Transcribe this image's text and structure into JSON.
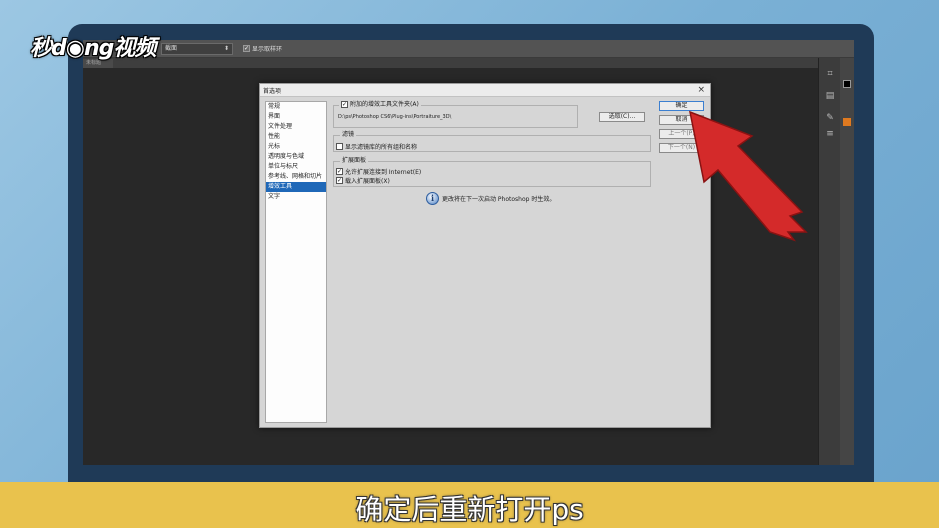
{
  "logo": {
    "text": "秒d◉ng视频"
  },
  "caption": "确定后重新打开ps",
  "optbar": {
    "select_value": "截面",
    "checkbox_label": "显示取样环"
  },
  "tab": {
    "label": "未标题"
  },
  "dialog": {
    "title": "首选项",
    "close": "×",
    "categories": [
      "常规",
      "界面",
      "文件处理",
      "性能",
      "光标",
      "透明度与色域",
      "单位与标尺",
      "参考线、网格和切片",
      "增效工具",
      "文字"
    ],
    "selected_category": "增效工具",
    "plugins_group": {
      "checkbox_label": "附加的增效工具文件夹(A)",
      "checked": true,
      "path": "D:\\ps\\Photoshop CS6\\Plug-ins\\Portraiture_3D\\",
      "choose_button": "选取(C)..."
    },
    "filters_group": {
      "title": "滤镜",
      "checkbox_label": "显示滤镜库的所有组和名称",
      "checked": false
    },
    "extensions_group": {
      "title": "扩展面板",
      "items": [
        {
          "label": "允许扩展连接到 Internet(E)",
          "checked": true
        },
        {
          "label": "载入扩展面板(X)",
          "checked": true
        }
      ]
    },
    "info_text": "更改将在下一次启动 Photoshop 时生效。",
    "buttons": {
      "ok": "确定",
      "cancel": "取消",
      "prev": "上一个(P)",
      "next": "下一个(N)"
    }
  },
  "colors": {
    "accent": "#1f68b8",
    "caption_bg": "#e9c24d",
    "arrow": "#d42a2a"
  }
}
